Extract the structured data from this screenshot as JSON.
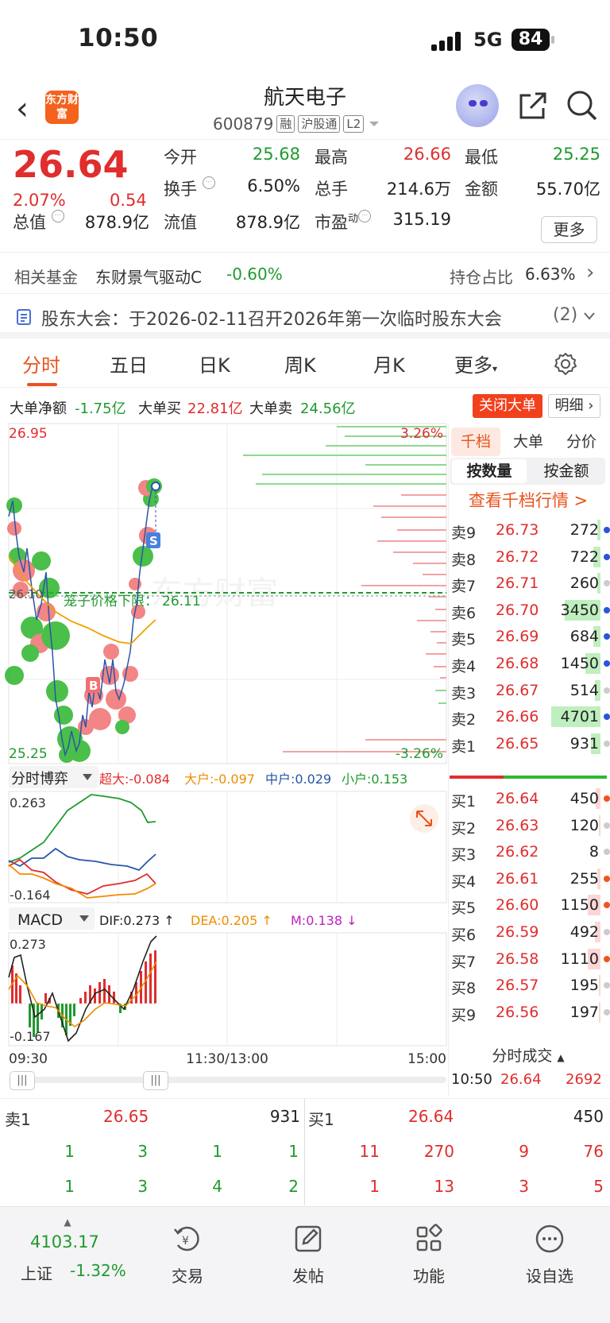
{
  "status": {
    "time": "10:50",
    "network": "5G",
    "battery": "84"
  },
  "header": {
    "logo_text": "东方财富",
    "title": "航天电子",
    "code": "600879",
    "tags": [
      "融",
      "沪股通",
      "L2"
    ]
  },
  "quote": {
    "price": "26.64",
    "change_pct": "2.07%",
    "change": "0.54",
    "fields": [
      {
        "label": "今开",
        "value": "25.68",
        "color": "green"
      },
      {
        "label": "最高",
        "value": "26.66",
        "color": "red"
      },
      {
        "label": "最低",
        "value": "25.25",
        "color": "green"
      },
      {
        "label": "换手",
        "value": "6.50%",
        "color": "black"
      },
      {
        "label": "总手",
        "value": "214.6万",
        "color": "black"
      },
      {
        "label": "金额",
        "value": "55.70亿",
        "color": "black"
      },
      {
        "label": "总值",
        "value": "878.9亿",
        "color": "black"
      },
      {
        "label": "流值",
        "value": "878.9亿",
        "color": "black"
      },
      {
        "label": "市盈",
        "value": "315.19",
        "color": "black"
      }
    ],
    "pe_sup": "动",
    "more": "更多"
  },
  "fund": {
    "label": "相关基金",
    "name": "东财景气驱动C",
    "change": "-0.60%",
    "hold_label": "持仓占比",
    "hold_value": "6.63%"
  },
  "notice": {
    "text": "股东大会：于2026-02-11召开2026年第一次临时股东大会",
    "count": "(2)"
  },
  "tabs": [
    "分时",
    "五日",
    "日K",
    "周K",
    "月K",
    "更多"
  ],
  "big_order": {
    "net_label": "大单净额",
    "net_value": "-1.75亿",
    "buy_label": "大单买",
    "buy_value": "22.81亿",
    "sell_label": "大单卖",
    "sell_value": "24.56亿",
    "close_button": "关闭大单",
    "detail_button": "明细"
  },
  "chart": {
    "price_high": "26.95",
    "price_low": "25.25",
    "price_mid": "26.10",
    "pct_high": "3.26%",
    "pct_low": "-3.26%",
    "cage_label": "笼子价格下限：",
    "cage_value": "26.11",
    "watermark": "东方财富",
    "marker_b": "B",
    "marker_s": "S",
    "flow_title": "分时博弈",
    "flow_legend": [
      {
        "text": "超大:-0.084",
        "color": "#e02d2d"
      },
      {
        "text": "大户:-0.097",
        "color": "#f08c00"
      },
      {
        "text": "中户:0.029",
        "color": "#2b55a8"
      },
      {
        "text": "小户:0.153",
        "color": "#1f9a2e"
      }
    ],
    "flow_max": "0.263",
    "flow_min": "-0.164",
    "macd_title": "MACD",
    "macd_legend": [
      {
        "text": "DIF:0.273 ↑",
        "color": "#222"
      },
      {
        "text": "DEA:0.205 ↑",
        "color": "#f08c00"
      },
      {
        "text": "M:0.138 ↓",
        "color": "#c020c0"
      }
    ],
    "macd_max": "0.273",
    "macd_min": "-0.167",
    "times": [
      "09:30",
      "11:30/13:00",
      "15:00"
    ]
  },
  "order_book": {
    "tabs": [
      "千档",
      "大单",
      "分价"
    ],
    "segments": [
      "按数量",
      "按金额"
    ],
    "link": "查看千档行情 >",
    "asks": [
      {
        "label": "卖9",
        "price": "26.73",
        "qty": "272",
        "fill": 0.06,
        "dot": "#2b55d8"
      },
      {
        "label": "卖8",
        "price": "26.72",
        "qty": "722",
        "fill": 0.15,
        "dot": "#2b55d8"
      },
      {
        "label": "卖7",
        "price": "26.71",
        "qty": "260",
        "fill": 0.06,
        "dot": "#cccccc"
      },
      {
        "label": "卖6",
        "price": "26.70",
        "qty": "3450",
        "fill": 0.73,
        "dot": "#2b55d8"
      },
      {
        "label": "卖5",
        "price": "26.69",
        "qty": "684",
        "fill": 0.15,
        "dot": "#2b55d8"
      },
      {
        "label": "卖4",
        "price": "26.68",
        "qty": "1450",
        "fill": 0.31,
        "dot": "#2b55d8"
      },
      {
        "label": "卖3",
        "price": "26.67",
        "qty": "514",
        "fill": 0.11,
        "dot": "#cccccc"
      },
      {
        "label": "卖2",
        "price": "26.66",
        "qty": "4701",
        "fill": 1.0,
        "dot": "#2b55d8"
      },
      {
        "label": "卖1",
        "price": "26.65",
        "qty": "931",
        "fill": 0.2,
        "dot": "#cccccc"
      }
    ],
    "bids": [
      {
        "label": "买1",
        "price": "26.64",
        "qty": "450",
        "fill": 0.1,
        "dot": "#f0541e"
      },
      {
        "label": "买2",
        "price": "26.63",
        "qty": "120",
        "fill": 0.03,
        "dot": "#cccccc"
      },
      {
        "label": "买3",
        "price": "26.62",
        "qty": "8",
        "fill": 0.0,
        "dot": "#cccccc"
      },
      {
        "label": "买4",
        "price": "26.61",
        "qty": "255",
        "fill": 0.06,
        "dot": "#f0541e"
      },
      {
        "label": "买5",
        "price": "26.60",
        "qty": "1150",
        "fill": 0.26,
        "dot": "#f0541e"
      },
      {
        "label": "买6",
        "price": "26.59",
        "qty": "492",
        "fill": 0.11,
        "dot": "#cccccc"
      },
      {
        "label": "买7",
        "price": "26.58",
        "qty": "1110",
        "fill": 0.25,
        "dot": "#f0541e"
      },
      {
        "label": "买8",
        "price": "26.57",
        "qty": "195",
        "fill": 0.04,
        "dot": "#cccccc"
      },
      {
        "label": "买9",
        "price": "26.56",
        "qty": "197",
        "fill": 0.04,
        "dot": "#cccccc"
      }
    ],
    "ticks_title": "分时成交",
    "last_tick": {
      "time": "10:50",
      "price": "26.64",
      "qty": "2692"
    }
  },
  "bottom_quote": {
    "sell": {
      "label": "卖1",
      "price": "26.65",
      "qty": "931",
      "row1": [
        "1",
        "3",
        "1",
        "1"
      ],
      "row2": [
        "1",
        "3",
        "4",
        "2"
      ]
    },
    "buy": {
      "label": "买1",
      "price": "26.64",
      "qty": "450",
      "row1": [
        "11",
        "270",
        "9",
        "76"
      ],
      "row2": [
        "1",
        "13",
        "3",
        "5"
      ]
    }
  },
  "nav": {
    "index_value": "4103.17",
    "index_name": "上证",
    "index_change": "-1.32%",
    "items": [
      "交易",
      "发帖",
      "功能",
      "设自选"
    ]
  },
  "colors": {
    "red": "#e02d2d",
    "green": "#1f9a2e",
    "accent": "#e8541e"
  }
}
